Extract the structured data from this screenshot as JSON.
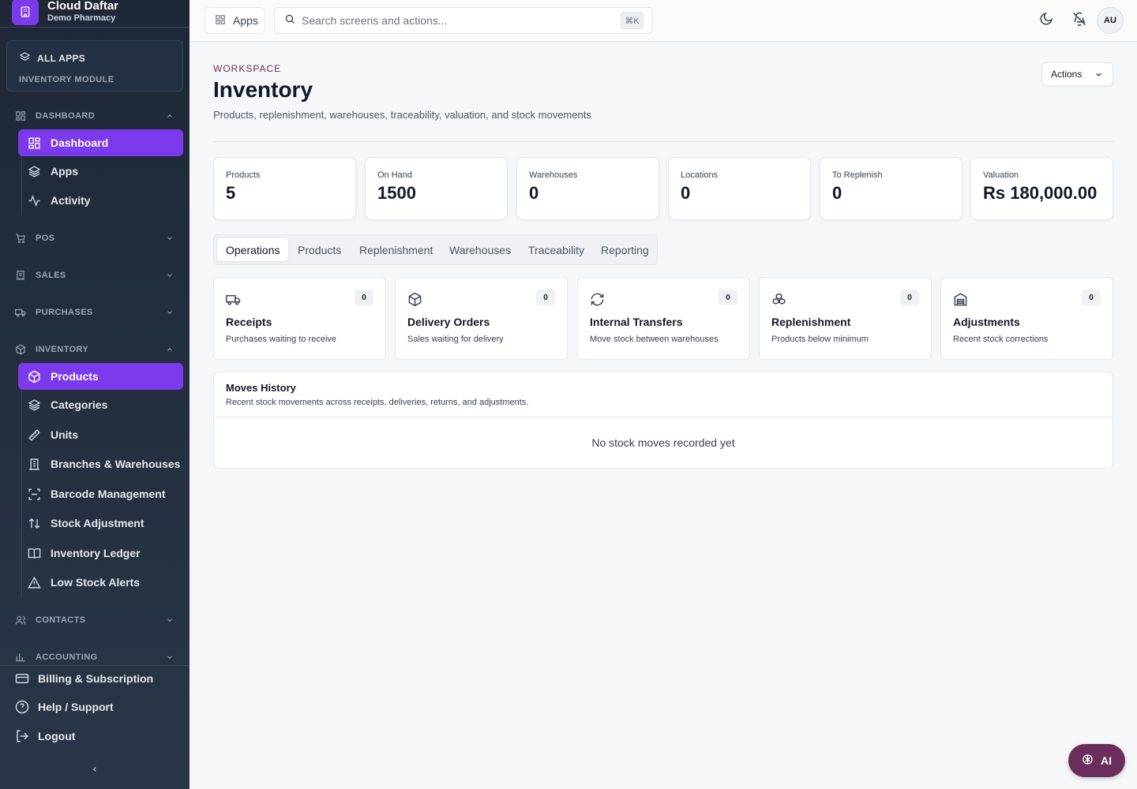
{
  "brand": {
    "name": "Cloud Daftar",
    "org": "Demo Pharmacy"
  },
  "sidebar": {
    "all_apps": "ALL APPS",
    "module": "INVENTORY MODULE",
    "sections": {
      "dashboard": "DASHBOARD",
      "pos": "POS",
      "sales": "SALES",
      "purchases": "PURCHASES",
      "inventory": "INVENTORY",
      "contacts": "CONTACTS",
      "accounting": "ACCOUNTING"
    },
    "dashboard_items": [
      "Dashboard",
      "Apps",
      "Activity"
    ],
    "inventory_items": [
      "Products",
      "Categories",
      "Units",
      "Branches & Warehouses",
      "Barcode Management",
      "Stock Adjustment",
      "Inventory Ledger",
      "Low Stock Alerts"
    ],
    "bottom": {
      "billing": "Billing & Subscription",
      "help": "Help / Support",
      "logout": "Logout"
    }
  },
  "topbar": {
    "apps_label": "Apps",
    "search_placeholder": "Search screens and actions...",
    "shortcut": "⌘K",
    "avatar": "AU"
  },
  "header": {
    "eyebrow": "WORKSPACE",
    "title": "Inventory",
    "subtitle": "Products, replenishment, warehouses, traceability, valuation, and stock movements",
    "actions_label": "Actions"
  },
  "stats": [
    {
      "label": "Products",
      "value": "5"
    },
    {
      "label": "On Hand",
      "value": "1500"
    },
    {
      "label": "Warehouses",
      "value": "0"
    },
    {
      "label": "Locations",
      "value": "0"
    },
    {
      "label": "To Replenish",
      "value": "0"
    },
    {
      "label": "Valuation",
      "value": "Rs 180,000.00"
    }
  ],
  "tabs": [
    "Operations",
    "Products",
    "Replenishment",
    "Warehouses",
    "Traceability",
    "Reporting"
  ],
  "operations": [
    {
      "title": "Receipts",
      "desc": "Purchases waiting to receive",
      "count": "0"
    },
    {
      "title": "Delivery Orders",
      "desc": "Sales waiting for delivery",
      "count": "0"
    },
    {
      "title": "Internal Transfers",
      "desc": "Move stock between warehouses",
      "count": "0"
    },
    {
      "title": "Replenishment",
      "desc": "Products below minimum",
      "count": "0"
    },
    {
      "title": "Adjustments",
      "desc": "Recent stock corrections",
      "count": "0"
    }
  ],
  "moves": {
    "title": "Moves History",
    "subtitle": "Recent stock movements across receipts, deliveries, returns, and adjustments.",
    "empty": "No stock moves recorded yet"
  },
  "ai_label": "AI",
  "colors": {
    "accent": "#7c3aed",
    "sidebar": "#1e2837",
    "plum": "#6b2d5c"
  }
}
